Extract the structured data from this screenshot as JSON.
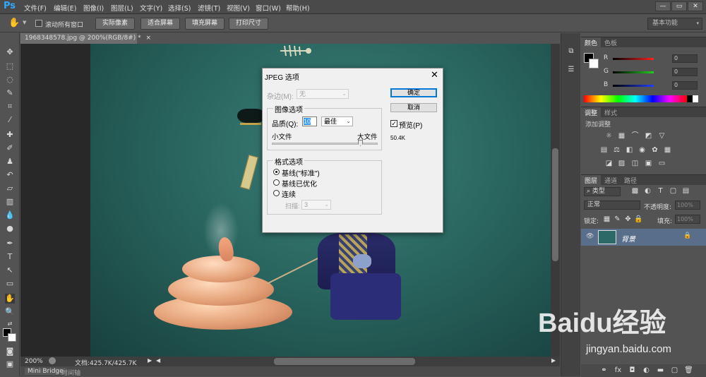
{
  "app": {
    "logo": "Ps"
  },
  "menu": [
    "文件(F)",
    "编辑(E)",
    "图像(I)",
    "图层(L)",
    "文字(Y)",
    "选择(S)",
    "滤镜(T)",
    "视图(V)",
    "窗口(W)",
    "帮助(H)"
  ],
  "window_controls": {
    "minimize": "—",
    "restore": "▭",
    "close": "✕"
  },
  "options_bar": {
    "scroll_all_label": "滚动所有窗口",
    "actual_pixels": "实际像素",
    "fit_screen": "适合屏幕",
    "fill_screen": "填充屏幕",
    "print_size": "打印尺寸",
    "workspace": "基本功能"
  },
  "document": {
    "tab_title": "1968348578.jpg @ 200%(RGB/8#) *"
  },
  "status": {
    "zoom": "200%",
    "doc_size": "文档:425.7K/425.7K"
  },
  "bottom_tabs": [
    "Mini Bridge",
    "时间轴"
  ],
  "color_panel": {
    "tabs": [
      "颜色",
      "色板"
    ],
    "channels": [
      {
        "label": "R",
        "value": "0",
        "color": "#ff3030"
      },
      {
        "label": "G",
        "value": "0",
        "color": "#30d030"
      },
      {
        "label": "B",
        "value": "0",
        "color": "#3050ff"
      }
    ]
  },
  "adjust_panel": {
    "tabs": [
      "调整",
      "样式"
    ],
    "hint": "添加调整"
  },
  "layers_panel": {
    "tabs": [
      "图层",
      "通道",
      "路径"
    ],
    "filter": "类型",
    "blend_mode": "正常",
    "opacity_label": "不透明度:",
    "opacity_value": "100%",
    "lock_label": "锁定:",
    "fill_label": "填充:",
    "fill_value": "100%",
    "layers": [
      {
        "name": "背景",
        "locked": true
      }
    ]
  },
  "dialog": {
    "title": "JPEG 选项",
    "matte_label": "杂边(M):",
    "matte_value": "无",
    "image_options": "图像选项",
    "quality_label": "品质(Q):",
    "quality_value": "10",
    "quality_preset": "最佳",
    "small_file": "小文件",
    "large_file": "大文件",
    "quality_slider": 10,
    "format_options": "格式选项",
    "baseline_standard": "基线(\"标准\")",
    "baseline_optimized": "基线已优化",
    "progressive": "连续",
    "scans_label": "扫描:",
    "scans_value": "3",
    "ok": "确定",
    "cancel": "取消",
    "preview_label": "预览(P)",
    "file_size": "50.4K"
  },
  "watermark": {
    "brand": "Baidu经验",
    "url": "jingyan.baidu.com"
  }
}
